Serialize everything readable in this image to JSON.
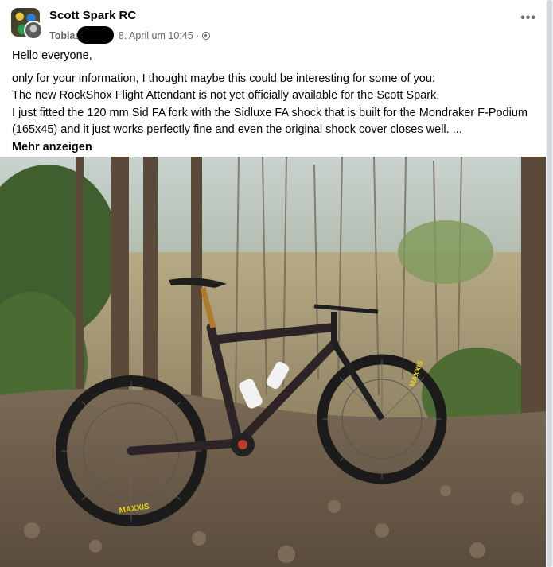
{
  "post": {
    "group_name": "Scott Spark RC",
    "author": "Tobias",
    "timestamp": "8. April um 10:45",
    "separator": "·",
    "privacy_icon": "globe-icon",
    "more_icon": "more-options-icon",
    "more_glyph": "•••",
    "greeting": "Hello everyone,",
    "lines": [
      "only for your information, I thought maybe this could be interesting for some of you:",
      "The new RockShox Flight Attendant is not yet officially available for the Scott Spark.",
      "I just fitted the 120 mm Sid FA fork with the Sidluxe FA shock that is built for the Mondraker F-Podium (165x45) and it just works perfectly fine and even the original shock cover closes well. ..."
    ],
    "see_more": "Mehr anzeigen"
  },
  "photo": {
    "subject": "mountain bike in forest",
    "tire_brand": "MAXXIS"
  }
}
